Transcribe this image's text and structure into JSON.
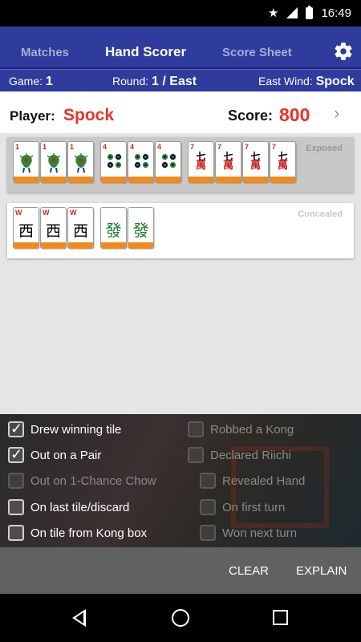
{
  "status": {
    "time": "16:49"
  },
  "tabs": {
    "matches": "Matches",
    "hand_scorer": "Hand Scorer",
    "score_sheet": "Score Sheet"
  },
  "info": {
    "game_label": "Game:",
    "game_value": "1",
    "round_label": "Round:",
    "round_value": "1 / East",
    "wind_label": "East Wind:",
    "wind_value": "Spock"
  },
  "player": {
    "label": "Player:",
    "name": "Spock",
    "score_label": "Score:",
    "score_value": "800"
  },
  "panels": {
    "exposed_label": "Exposed",
    "concealed_label": "Concealed"
  },
  "tiles": {
    "exposed": [
      {
        "suit": "bamboo",
        "rank": "1"
      },
      {
        "suit": "bamboo",
        "rank": "1"
      },
      {
        "suit": "bamboo",
        "rank": "1"
      },
      {
        "suit": "circles",
        "rank": "4"
      },
      {
        "suit": "circles",
        "rank": "4"
      },
      {
        "suit": "circles",
        "rank": "4"
      },
      {
        "suit": "characters",
        "rank": "7",
        "char": "七",
        "wan": "萬"
      },
      {
        "suit": "characters",
        "rank": "7",
        "char": "七",
        "wan": "萬"
      },
      {
        "suit": "characters",
        "rank": "7",
        "char": "七",
        "wan": "萬"
      },
      {
        "suit": "characters",
        "rank": "7",
        "char": "七",
        "wan": "萬"
      }
    ],
    "concealed": [
      {
        "suit": "wind",
        "rank": "W",
        "char": "西"
      },
      {
        "suit": "wind",
        "rank": "W",
        "char": "西"
      },
      {
        "suit": "wind",
        "rank": "W",
        "char": "西"
      },
      {
        "suit": "dragon",
        "char": "發"
      },
      {
        "suit": "dragon",
        "char": "發"
      }
    ]
  },
  "options": {
    "drew_winning_tile": "Drew winning tile",
    "robbed_a_kong": "Robbed a Kong",
    "out_on_a_pair": "Out on a Pair",
    "declared_riichi": "Declared Riichi",
    "out_on_1_chance_chow": "Out on 1-Chance Chow",
    "revealed_hand": "Revealed Hand",
    "on_last_tile": "On last tile/discard",
    "on_first_turn": "On first turn",
    "on_tile_from_kong_box": "On tile from Kong box",
    "won_next_turn": "Won next turn"
  },
  "actions": {
    "clear": "CLEAR",
    "explain": "EXPLAIN"
  },
  "colors": {
    "primary": "#2f3b9d",
    "accent_red": "#e8322a",
    "tile_back": "#f08a1c"
  }
}
